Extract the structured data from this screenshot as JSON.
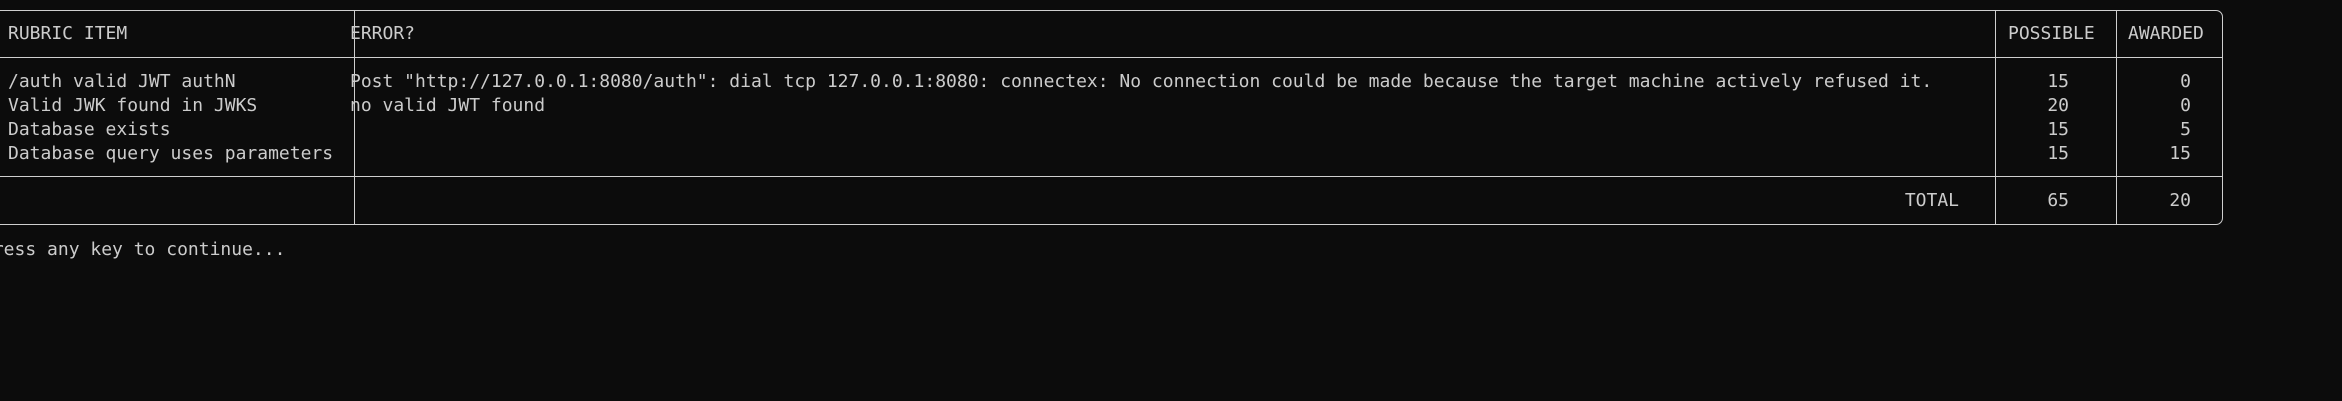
{
  "table": {
    "headers": {
      "item": "RUBRIC ITEM",
      "error": "ERROR?",
      "possible": "POSSIBLE",
      "awarded": "AWARDED"
    },
    "rows": [
      {
        "item": "/auth valid JWT authN",
        "error": "Post \"http://127.0.0.1:8080/auth\": dial tcp 127.0.0.1:8080: connectex: No connection could be made because the target machine actively refused it.",
        "possible": "15",
        "awarded": "0"
      },
      {
        "item": "Valid JWK found in JWKS",
        "error": "no valid JWT found",
        "possible": "20",
        "awarded": "0"
      },
      {
        "item": "Database exists",
        "error": "",
        "possible": "15",
        "awarded": "5"
      },
      {
        "item": "Database query uses parameters",
        "error": "",
        "possible": "15",
        "awarded": "15"
      }
    ],
    "total": {
      "label": "TOTAL",
      "possible": "65",
      "awarded": "20"
    }
  },
  "prompt": "Press any key to continue..."
}
